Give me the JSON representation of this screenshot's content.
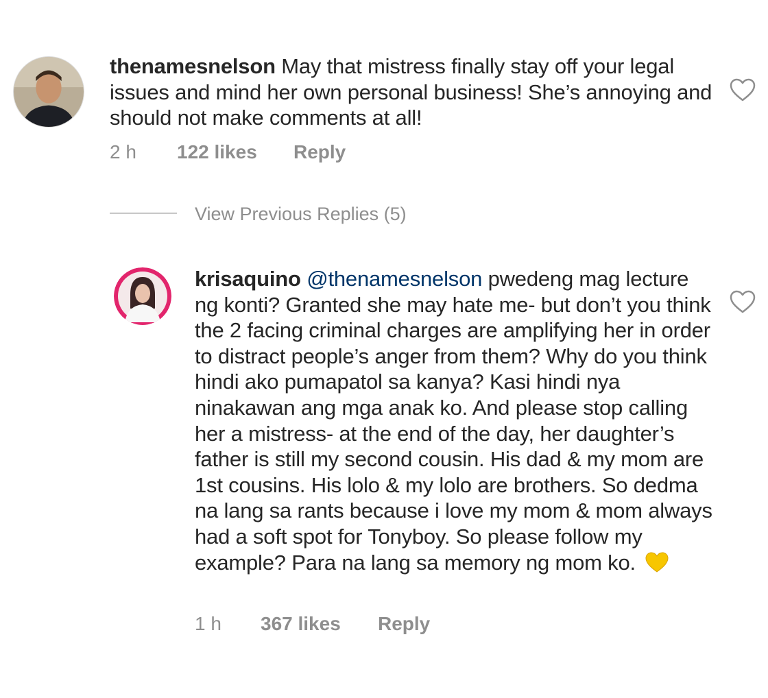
{
  "comments": [
    {
      "username": "thenamesnelson",
      "mention": "",
      "text": "May that mistress finally stay off your legal issues and mind her own personal business! She’s annoying and should not make comments at all!",
      "time": "2 h",
      "likes": "122 likes",
      "reply_label": "Reply"
    },
    {
      "username": "krisaquino",
      "mention": "@thenamesnelson",
      "text": "pwedeng mag lecture ng konti? Granted she may hate me- but don’t you think the 2 facing criminal charges are amplifying her in order to distract people’s anger from them? Why do you think hindi ako pumapatol sa kanya? Kasi hindi nya ninakawan ang mga anak ko. And please stop calling her a mistress- at the end of the day, her daughter’s father is still my second cousin. His dad & my mom are 1st cousins. His lolo & my lolo are brothers. So dedma na lang sa rants because i love my mom & mom always had a soft spot for Tonyboy. So please follow my example? Para na lang sa memory ng mom ko.",
      "emoji": "yellow-heart",
      "time": "1 h",
      "likes": "367 likes",
      "reply_label": "Reply"
    }
  ],
  "replies_toggle": {
    "label": "View Previous Replies (5)"
  },
  "icons": {
    "like": "heart-outline-icon",
    "emoji": "yellow-heart-emoji"
  },
  "colors": {
    "text": "#262626",
    "muted": "#8e8e8e",
    "mention": "#003569",
    "emoji": "#f7c600"
  }
}
